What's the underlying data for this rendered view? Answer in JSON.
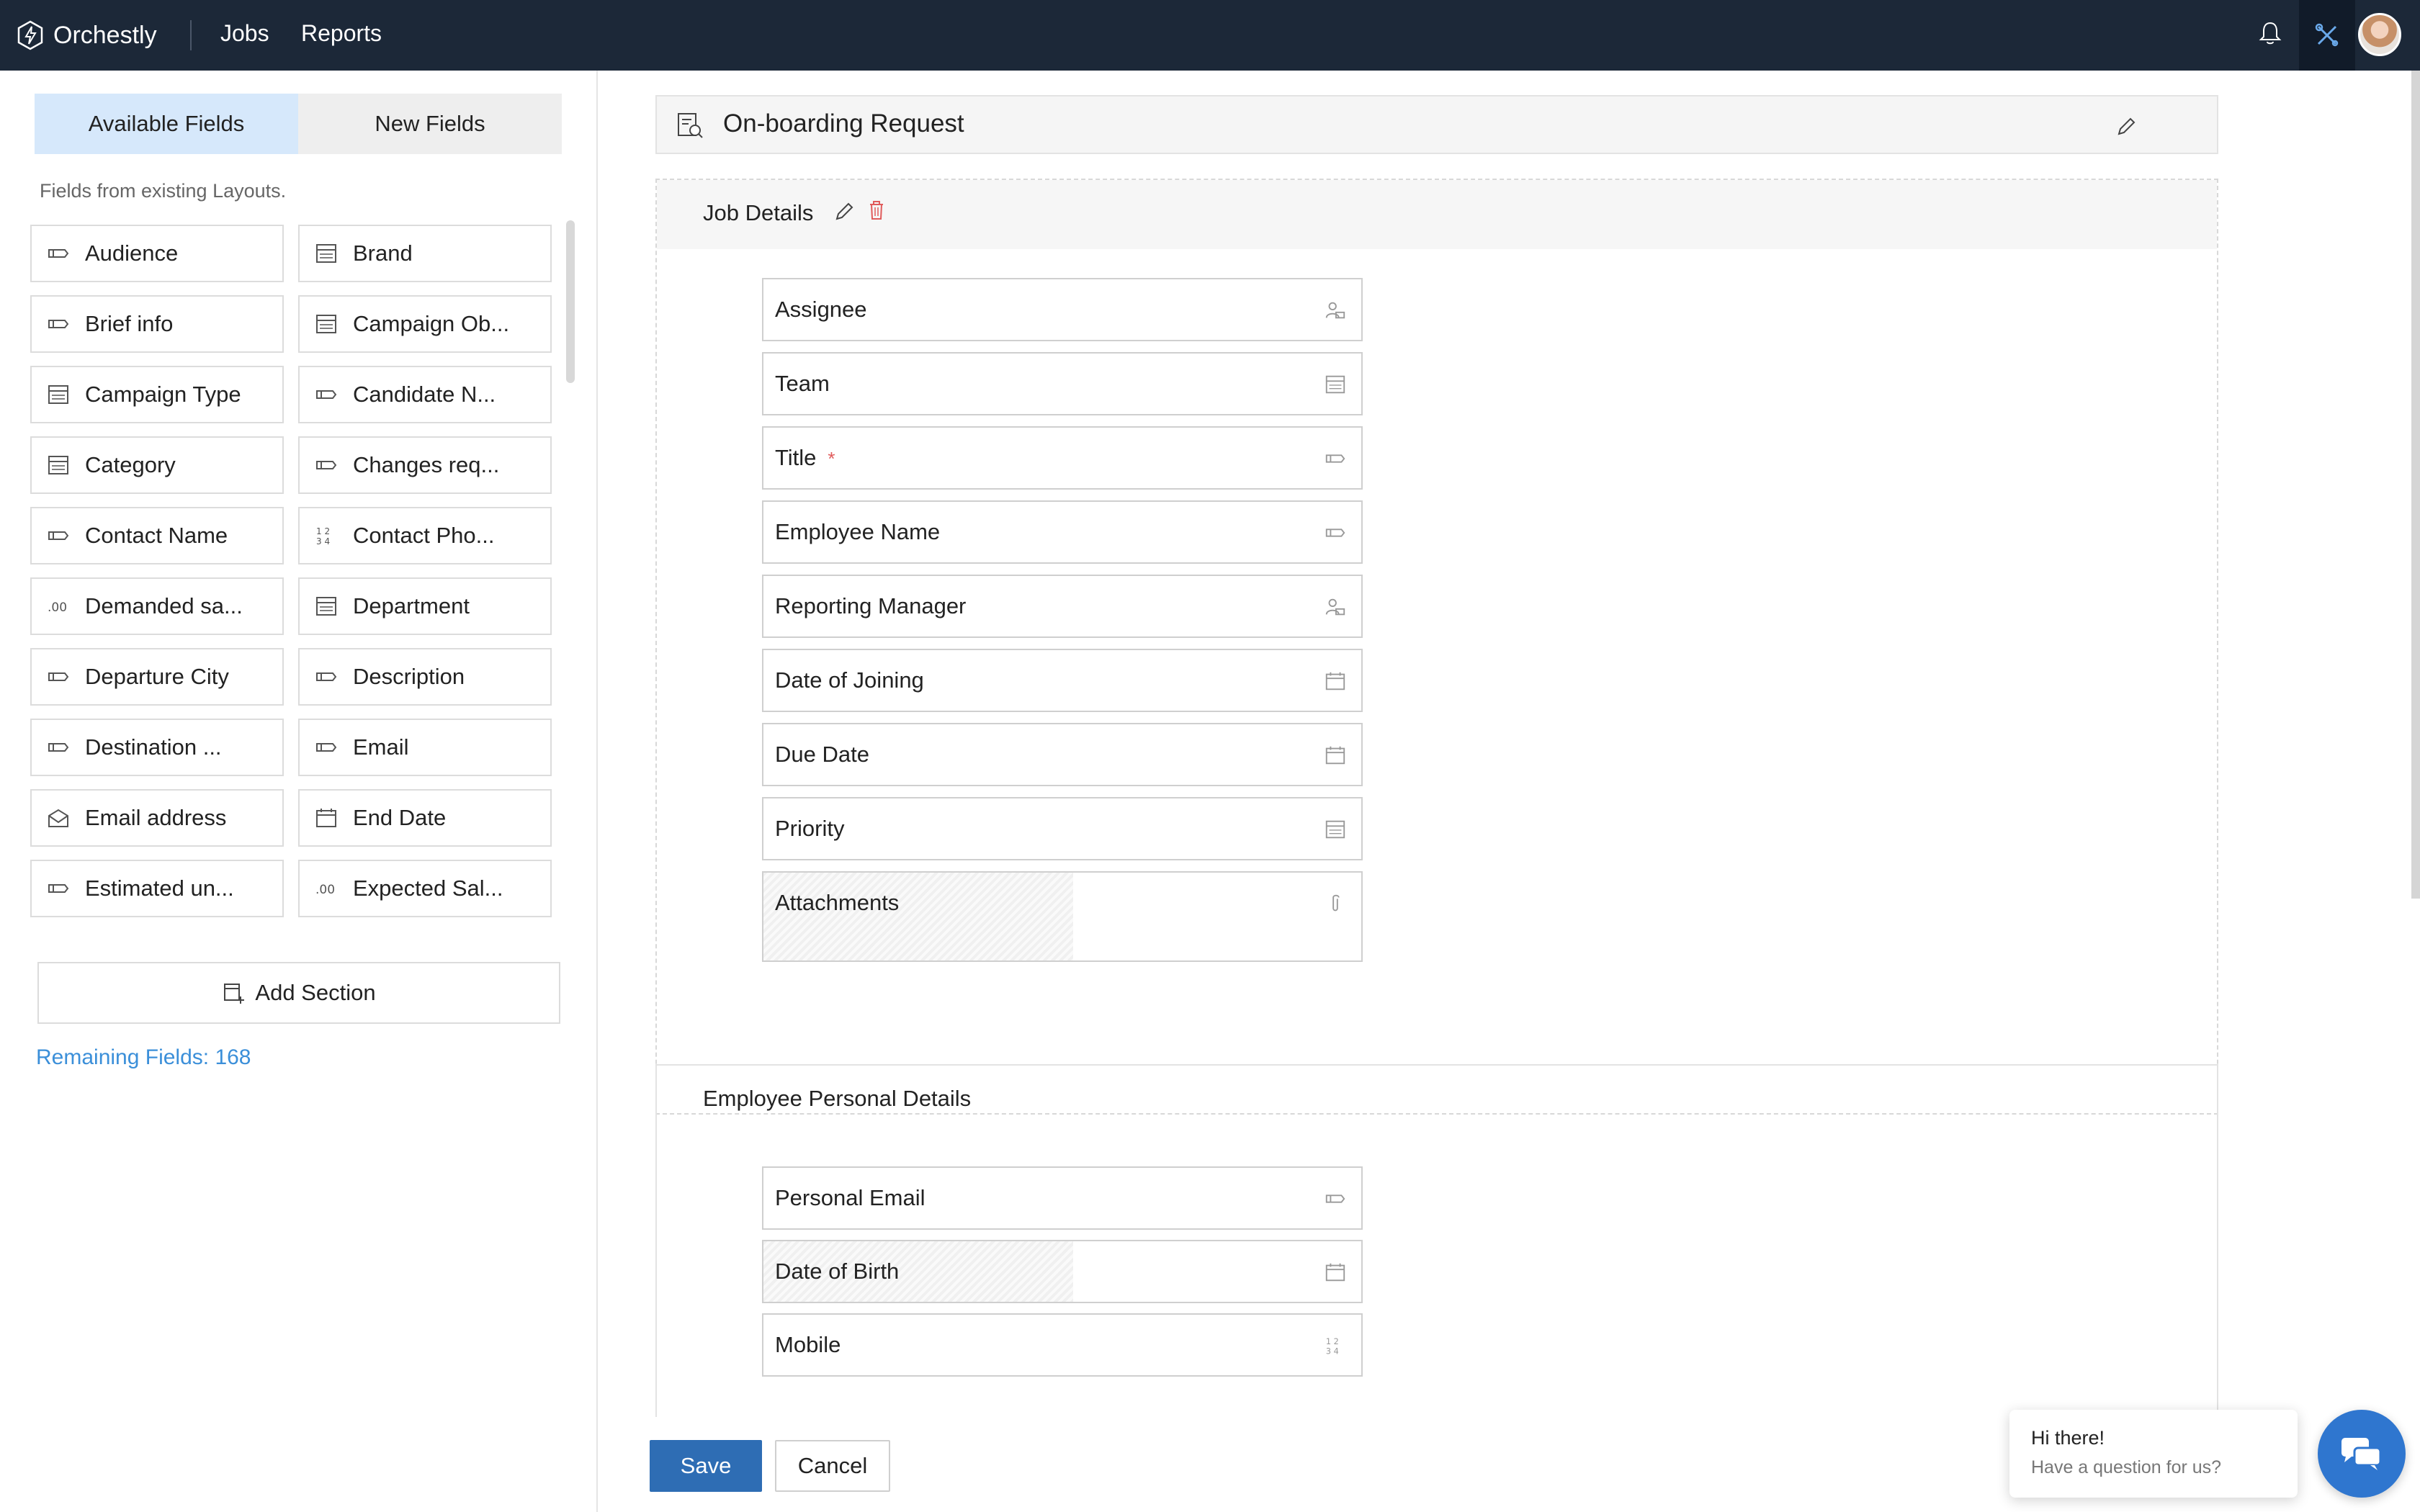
{
  "app": {
    "name": "Orchestly"
  },
  "nav": {
    "jobs": "Jobs",
    "reports": "Reports"
  },
  "left_panel": {
    "tabs": [
      {
        "label": "Available Fields",
        "active": true
      },
      {
        "label": "New Fields",
        "active": false
      }
    ],
    "note": "Fields from existing Layouts.",
    "fields": [
      {
        "label": "Audience",
        "icon": "single-line-icon"
      },
      {
        "label": "Brand",
        "icon": "dropdown-icon"
      },
      {
        "label": "Brief info",
        "icon": "single-line-icon"
      },
      {
        "label": "Campaign Ob...",
        "icon": "dropdown-icon"
      },
      {
        "label": "Campaign Type",
        "icon": "dropdown-icon"
      },
      {
        "label": "Candidate N...",
        "icon": "single-line-icon"
      },
      {
        "label": "Category",
        "icon": "dropdown-icon"
      },
      {
        "label": "Changes req...",
        "icon": "single-line-icon"
      },
      {
        "label": "Contact Name",
        "icon": "single-line-icon"
      },
      {
        "label": "Contact Pho...",
        "icon": "number-icon"
      },
      {
        "label": "Demanded sa...",
        "icon": "decimal-icon"
      },
      {
        "label": "Department",
        "icon": "dropdown-icon"
      },
      {
        "label": "Departure City",
        "icon": "single-line-icon"
      },
      {
        "label": "Description",
        "icon": "single-line-icon"
      },
      {
        "label": "Destination ...",
        "icon": "single-line-icon"
      },
      {
        "label": "Email",
        "icon": "single-line-icon"
      },
      {
        "label": "Email address",
        "icon": "email-icon"
      },
      {
        "label": "End Date",
        "icon": "calendar-icon"
      },
      {
        "label": "Estimated un...",
        "icon": "single-line-icon"
      },
      {
        "label": "Expected Sal...",
        "icon": "decimal-icon"
      }
    ],
    "add_section": "Add Section",
    "remaining": "Remaining Fields: 168"
  },
  "layout": {
    "title": "On-boarding Request"
  },
  "sections": {
    "job": {
      "title": "Job Details",
      "fields": [
        {
          "label": "Assignee",
          "icon": "user-icon",
          "required": false
        },
        {
          "label": "Team",
          "icon": "dropdown-icon",
          "required": false
        },
        {
          "label": "Title",
          "icon": "single-line-icon",
          "required": true
        },
        {
          "label": "Employee Name",
          "icon": "single-line-icon",
          "required": false
        },
        {
          "label": "Reporting Manager",
          "icon": "user-icon",
          "required": false
        },
        {
          "label": "Date of Joining",
          "icon": "calendar-icon",
          "required": false
        },
        {
          "label": "Due Date",
          "icon": "calendar-icon",
          "required": false
        },
        {
          "label": "Priority",
          "icon": "dropdown-icon",
          "required": false
        },
        {
          "label": "Attachments",
          "icon": "paperclip-icon",
          "required": false
        }
      ]
    },
    "personal": {
      "title": "Employee Personal Details",
      "fields": [
        {
          "label": "Personal Email",
          "icon": "single-line-icon"
        },
        {
          "label": "Date of Birth",
          "icon": "calendar-icon"
        },
        {
          "label": "Mobile",
          "icon": "number-icon"
        }
      ]
    }
  },
  "required_mark": "*",
  "actions": {
    "save": "Save",
    "cancel": "Cancel"
  },
  "chat": {
    "greeting": "Hi there!",
    "prompt": "Have a question for us?"
  },
  "colors": {
    "topbar": "#1c2838",
    "accent": "#2e6db4",
    "link": "#3b8fd9",
    "active_tab": "#d6e8fb",
    "required": "#e05b5b"
  }
}
